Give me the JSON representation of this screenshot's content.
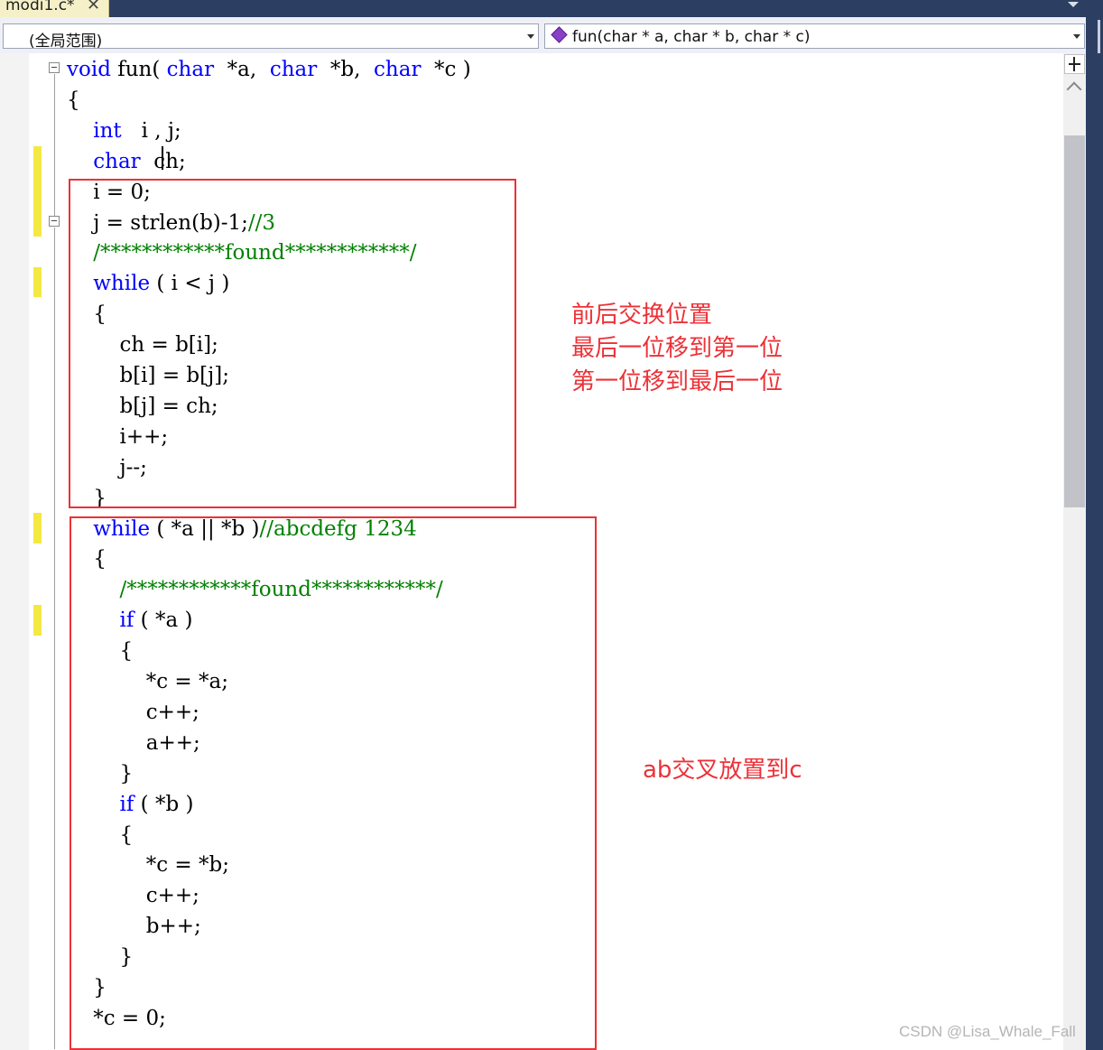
{
  "tab": {
    "title": "modi1.c*",
    "close": "✕"
  },
  "nav": {
    "scope": "(全局范围)",
    "member": "fun(char * a, char * b, char * c)"
  },
  "code_lines": [
    [
      {
        "t": "void",
        "k": "kw"
      },
      {
        "t": " fun( "
      },
      {
        "t": "char",
        "k": "kw"
      },
      {
        "t": "  *a,  "
      },
      {
        "t": "char",
        "k": "kw"
      },
      {
        "t": "  *b,  "
      },
      {
        "t": "char",
        "k": "kw"
      },
      {
        "t": "  *c )"
      }
    ],
    [
      {
        "t": "{"
      }
    ],
    [
      {
        "t": "    "
      },
      {
        "t": "int",
        "k": "kw"
      },
      {
        "t": "   i , j;"
      }
    ],
    [
      {
        "t": "    "
      },
      {
        "t": "char",
        "k": "kw"
      },
      {
        "t": "  ch;"
      }
    ],
    [
      {
        "t": "    i = 0;"
      }
    ],
    [
      {
        "t": "    j = strlen(b)-1;"
      },
      {
        "t": "//3",
        "k": "cm"
      }
    ],
    [
      {
        "t": "    "
      },
      {
        "t": "/************found************/",
        "k": "cm"
      }
    ],
    [
      {
        "t": "    "
      },
      {
        "t": "while",
        "k": "kw"
      },
      {
        "t": " ( i < j )"
      }
    ],
    [
      {
        "t": "    {"
      }
    ],
    [
      {
        "t": "        ch = b[i];"
      }
    ],
    [
      {
        "t": "        b[i] = b[j];"
      }
    ],
    [
      {
        "t": "        b[j] = ch;"
      }
    ],
    [
      {
        "t": "        i++;"
      }
    ],
    [
      {
        "t": "        j--;"
      }
    ],
    [
      {
        "t": "    }"
      }
    ],
    [
      {
        "t": "    "
      },
      {
        "t": "while",
        "k": "kw"
      },
      {
        "t": " ( *a || *b )"
      },
      {
        "t": "//abcdefg 1234",
        "k": "cm"
      }
    ],
    [
      {
        "t": "    {"
      }
    ],
    [
      {
        "t": "        "
      },
      {
        "t": "/************found************/",
        "k": "cm"
      }
    ],
    [
      {
        "t": "        "
      },
      {
        "t": "if",
        "k": "kw"
      },
      {
        "t": " ( *a )"
      }
    ],
    [
      {
        "t": "        {"
      }
    ],
    [
      {
        "t": "            *c = *a;"
      }
    ],
    [
      {
        "t": "            c++;"
      }
    ],
    [
      {
        "t": "            a++;"
      }
    ],
    [
      {
        "t": "        }"
      }
    ],
    [
      {
        "t": "        "
      },
      {
        "t": "if",
        "k": "kw"
      },
      {
        "t": " ( *b )"
      }
    ],
    [
      {
        "t": "        {"
      }
    ],
    [
      {
        "t": "            *c = *b;"
      }
    ],
    [
      {
        "t": "            c++;"
      }
    ],
    [
      {
        "t": "            b++;"
      }
    ],
    [
      {
        "t": "        }"
      }
    ],
    [
      {
        "t": "    }"
      }
    ],
    [
      {
        "t": "    *c = 0;"
      }
    ]
  ],
  "annotations": {
    "swap_note": [
      "前后交换位置",
      "最后一位移到第一位",
      "第一位移到最后一位"
    ],
    "merge_note": "ab交叉放置到c",
    "color": "#ec3137"
  },
  "syntax_colors": {
    "keyword": "#0000ff",
    "comment": "#008000",
    "text": "#000000"
  },
  "watermark": "CSDN @Lisa_Whale_Fall"
}
